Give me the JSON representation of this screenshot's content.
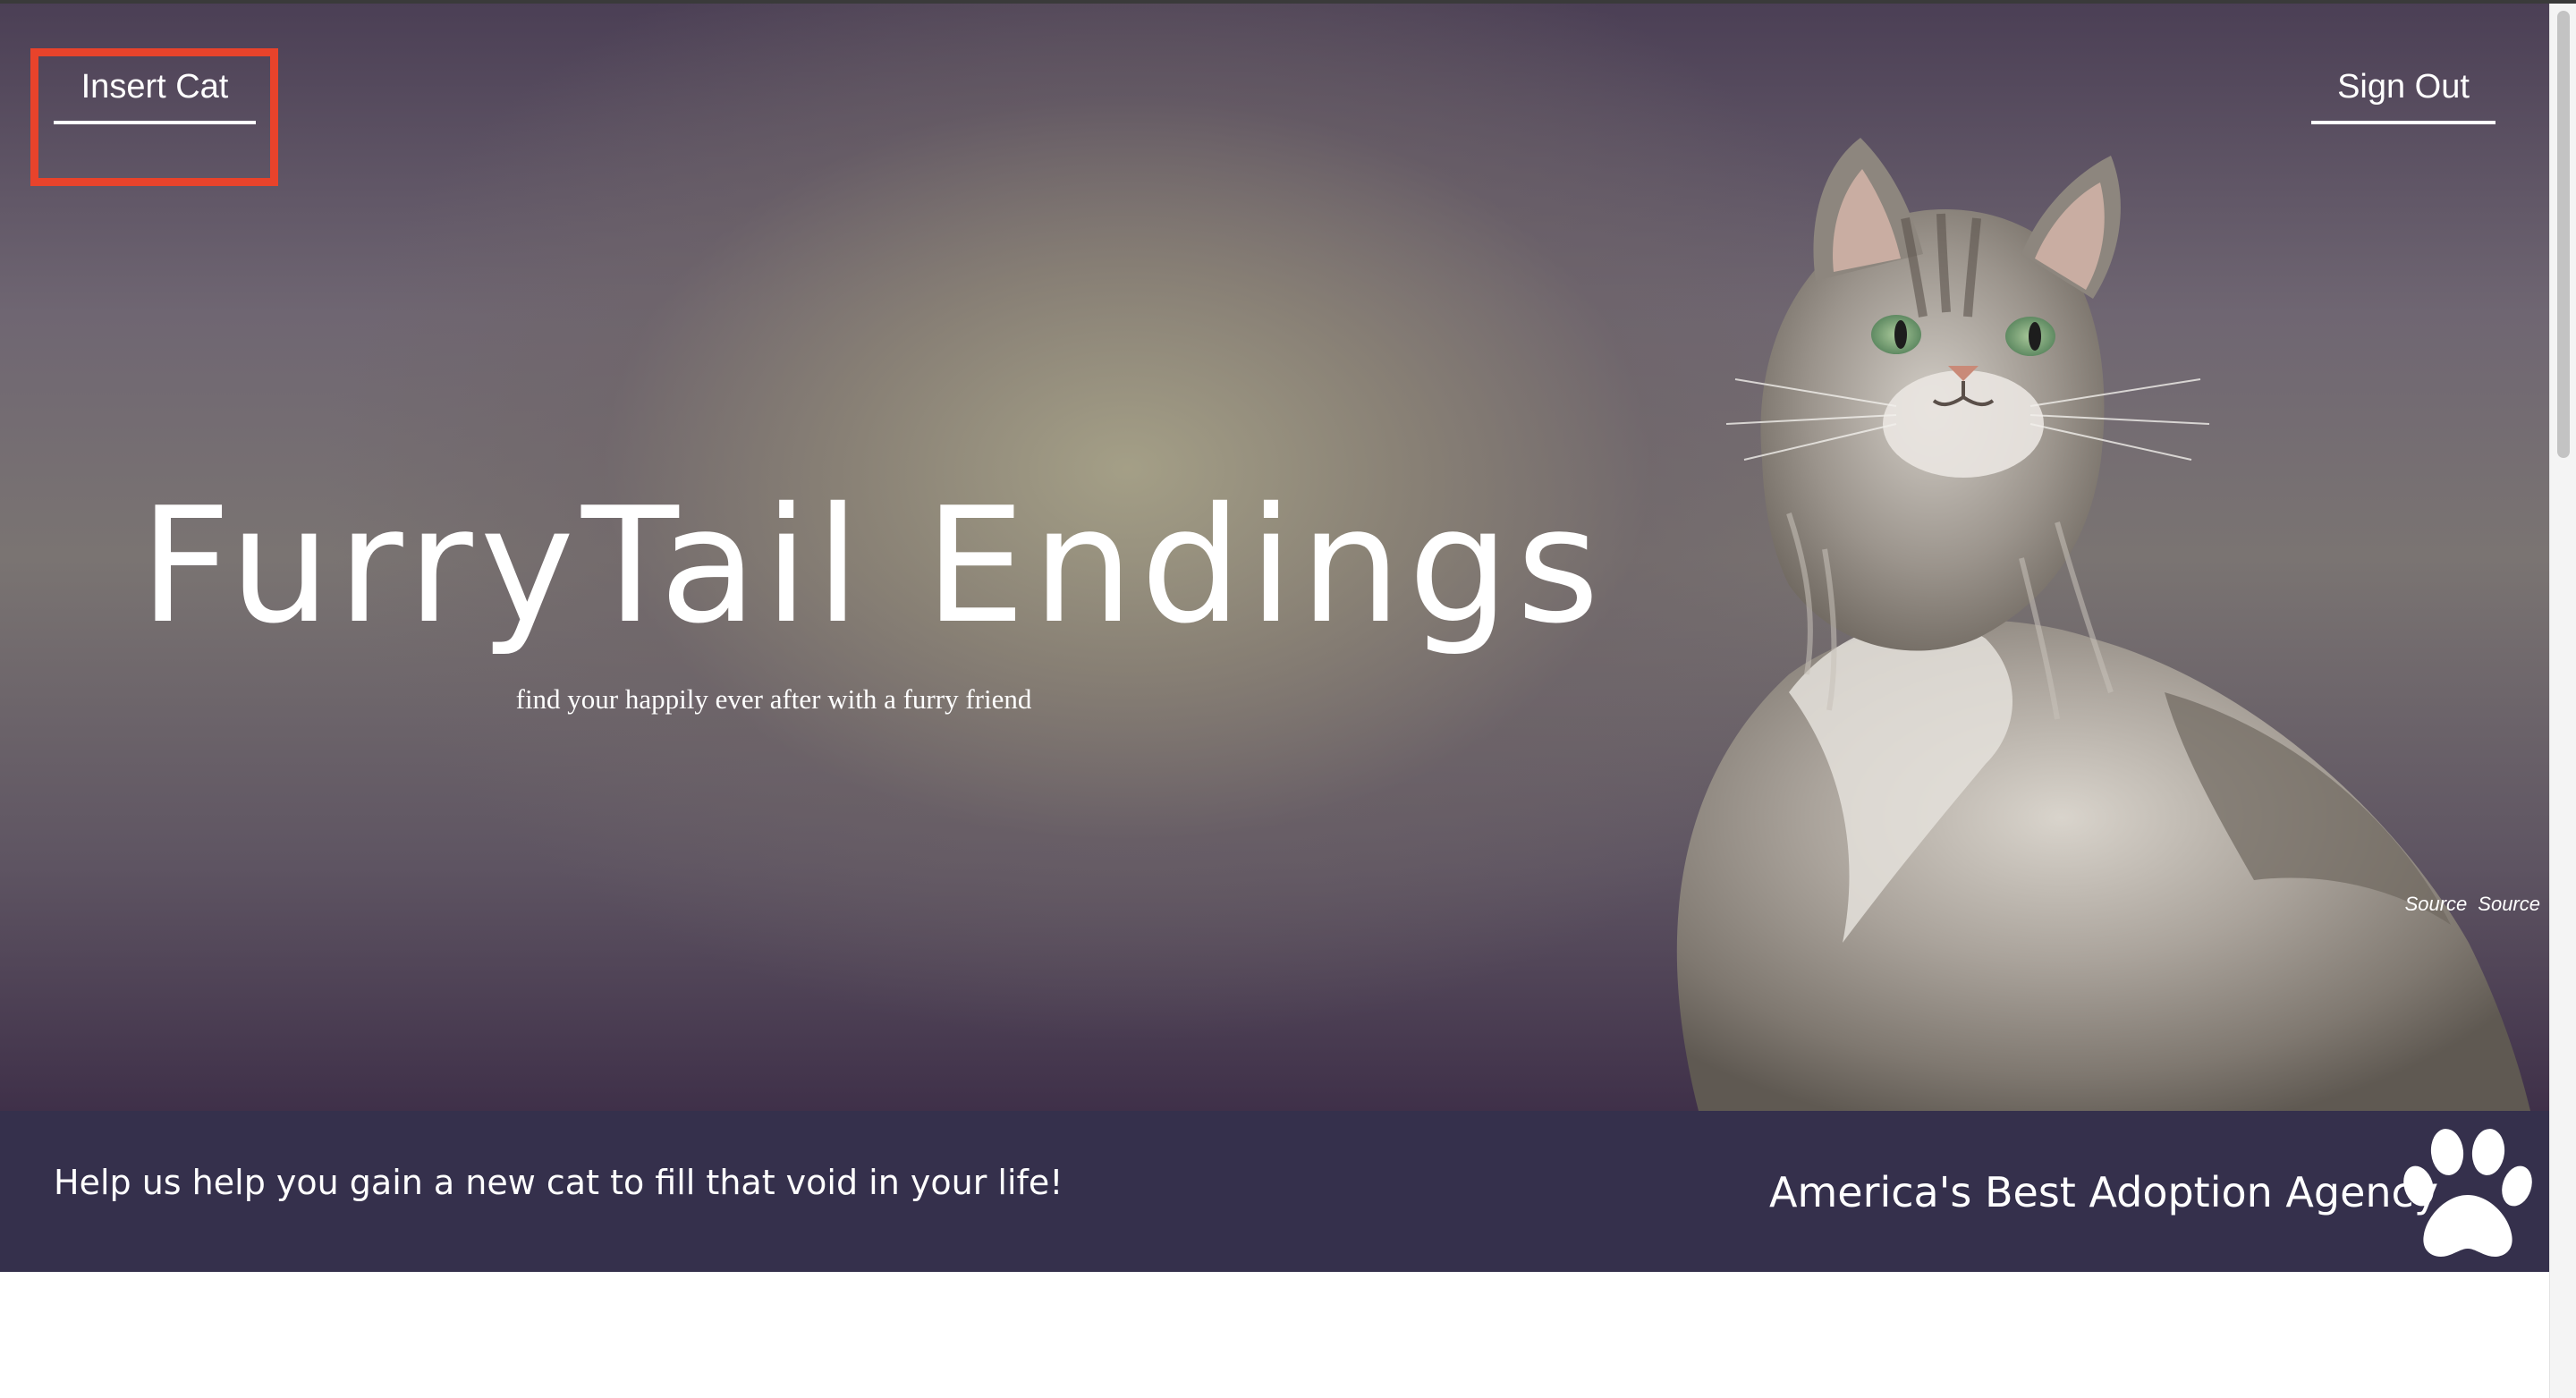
{
  "nav": {
    "insert_cat": "Insert Cat",
    "sign_out": "Sign Out"
  },
  "hero": {
    "title": "FurryTail Endings",
    "tagline": "find your happily ever after with a furry friend",
    "credits": [
      "Source",
      "Source"
    ],
    "image": "cat-photo"
  },
  "footer": {
    "message": "Help us help you gain a new cat to fill that void in your life!",
    "agency": "America's Best Adoption Agency",
    "icon": "paw-icon"
  },
  "colors": {
    "highlight": "#e8432b",
    "footer_band": "#35304c",
    "text": "#ffffff"
  }
}
